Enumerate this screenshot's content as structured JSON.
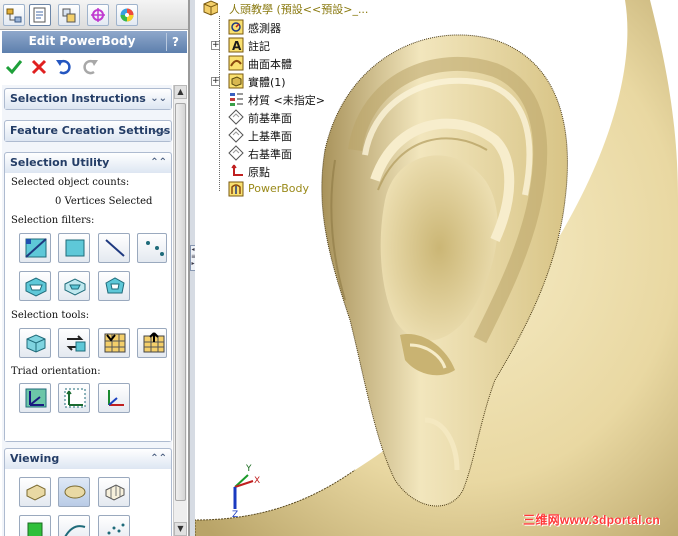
{
  "tabs": [
    {
      "name": "feature-manager-tab",
      "icon": "feature-tree-icon"
    },
    {
      "name": "property-manager-tab",
      "icon": "property-icon"
    },
    {
      "name": "configuration-manager-tab",
      "icon": "configuration-icon"
    },
    {
      "name": "dimxpert-tab",
      "icon": "crosshair-icon"
    },
    {
      "name": "display-manager-tab",
      "icon": "color-wheel-icon"
    }
  ],
  "panel": {
    "title": "Edit PowerBody",
    "help": "?"
  },
  "groups": {
    "selection_instructions": "Selection Instructions",
    "feature_creation_settings": "Feature Creation Settings",
    "selection_utility": "Selection Utility",
    "viewing": "Viewing"
  },
  "selection_utility": {
    "counts_label": "Selected object counts:",
    "counts_value": "0 Vertices Selected",
    "filters_label": "Selection filters:",
    "tools_label": "Selection tools:",
    "triad_label": "Triad orientation:"
  },
  "tree": {
    "root": "人頭教學 (預設<<預設>_...",
    "items": [
      {
        "label": "感測器",
        "icon": "sensor-icon"
      },
      {
        "label": "註記",
        "icon": "annotation-icon"
      },
      {
        "label": "曲面本體",
        "icon": "surface-bodies-icon"
      },
      {
        "label": "實體(1)",
        "icon": "solid-bodies-icon"
      },
      {
        "label": "材質 <未指定>",
        "icon": "material-icon"
      },
      {
        "label": "前基準面",
        "icon": "plane-icon"
      },
      {
        "label": "上基準面",
        "icon": "plane-icon"
      },
      {
        "label": "右基準面",
        "icon": "plane-icon"
      },
      {
        "label": "原點",
        "icon": "origin-icon"
      },
      {
        "label": "PowerBody",
        "icon": "powerbody-icon"
      }
    ]
  },
  "watermark": "三维网www.3dportal.cn",
  "colors": {
    "title_bar": "#6e8cb8",
    "group_header_text": "#243d66",
    "model_surface": "#e8d8a0",
    "powerbody_text": "#9a8a1a",
    "watermark": "#ff3a3a"
  }
}
